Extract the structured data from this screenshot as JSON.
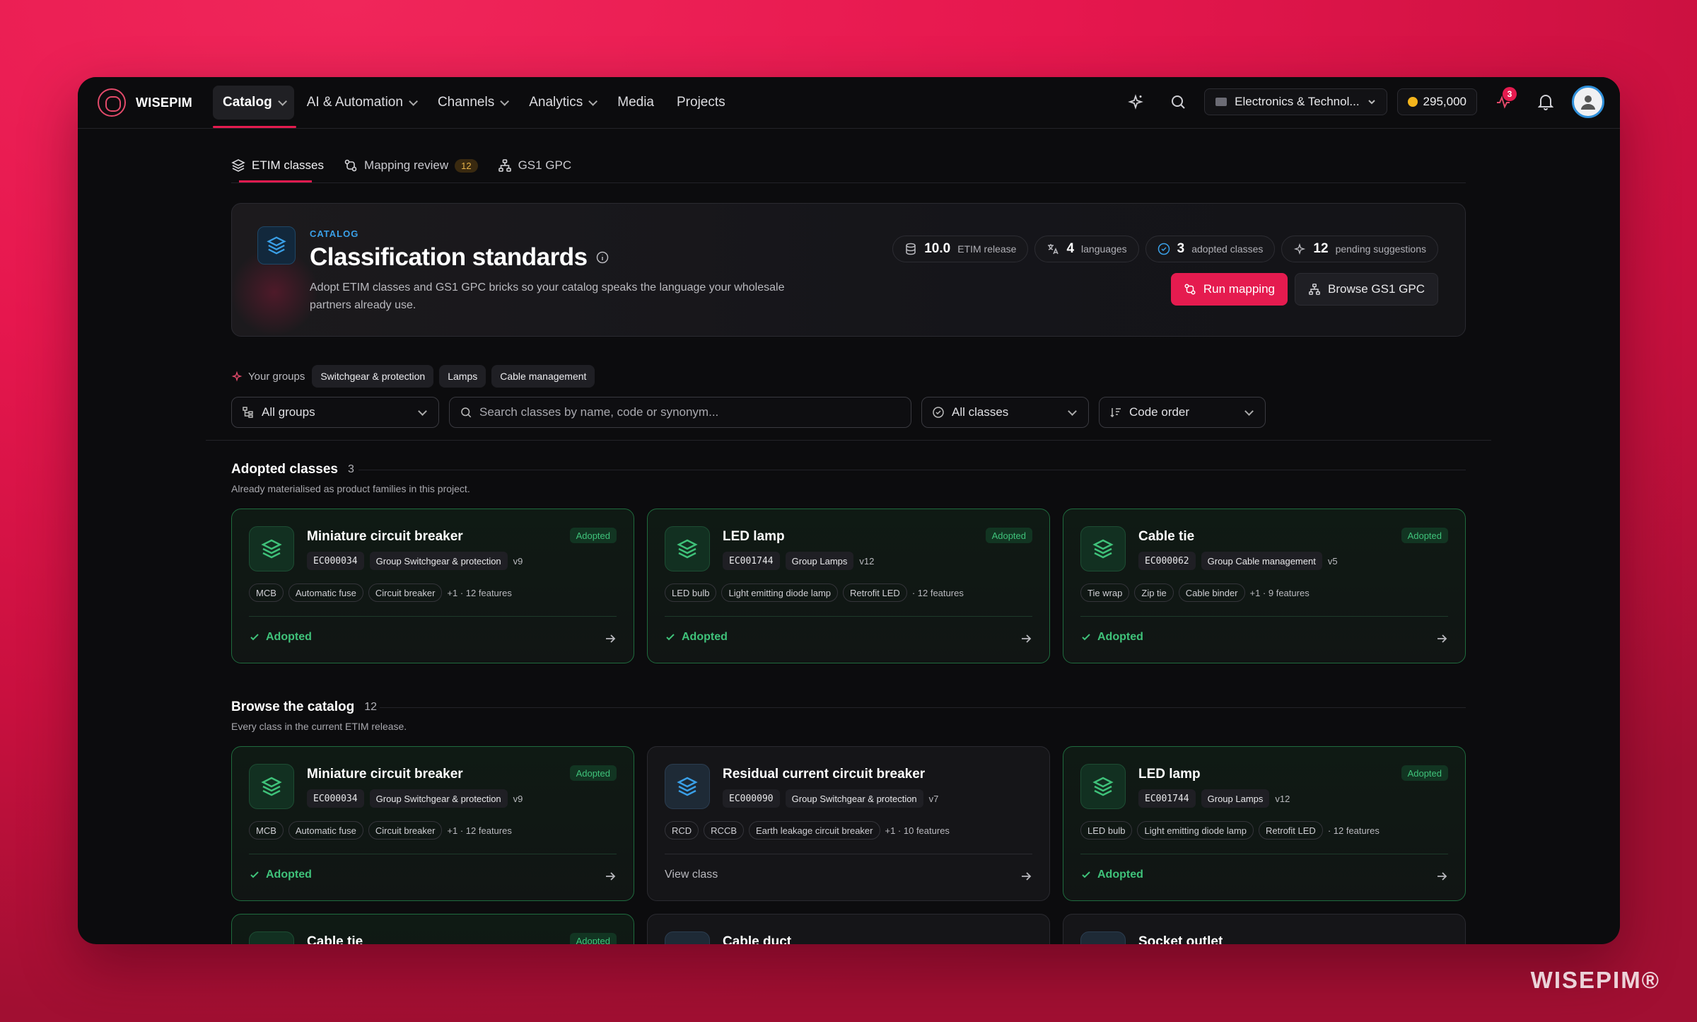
{
  "nav": {
    "logo": "WISEPIM",
    "menu": [
      {
        "label": "Catalog"
      },
      {
        "label": "AI & Automation"
      },
      {
        "label": "Channels"
      },
      {
        "label": "Analytics"
      },
      {
        "label": "Media"
      },
      {
        "label": "Projects"
      }
    ],
    "workspace": "Electronics & Technol...",
    "credits": "295,000",
    "notification_count": "3"
  },
  "subtabs": [
    {
      "label": "ETIM classes"
    },
    {
      "label": "Mapping review",
      "count": "12"
    },
    {
      "label": "GS1 GPC"
    }
  ],
  "hero": {
    "eyebrow": "CATALOG",
    "title": "Classification standards",
    "description": "Adopt ETIM classes and GS1 GPC bricks so your catalog speaks the language your wholesale partners already use.",
    "stats": [
      {
        "value": "10.0",
        "label": "ETIM release"
      },
      {
        "value": "4",
        "label": "languages"
      },
      {
        "value": "3",
        "label": "adopted classes"
      },
      {
        "value": "12",
        "label": "pending suggestions"
      }
    ],
    "run_mapping": "Run mapping",
    "browse_gs1": "Browse GS1 GPC"
  },
  "groups": {
    "label": "Your groups",
    "chips": [
      "Switchgear & protection",
      "Lamps",
      "Cable management"
    ]
  },
  "filters": {
    "groups": "All groups",
    "search_placeholder": "Search classes by name, code or synonym...",
    "classes": "All classes",
    "order": "Code order"
  },
  "adopted_section": {
    "title": "Adopted classes",
    "count": "3",
    "subtitle": "Already materialised as product families in this project."
  },
  "browse_section": {
    "title": "Browse the catalog",
    "count": "12",
    "subtitle": "Every class in the current ETIM release."
  },
  "colors": {
    "accent": "#e51b4f",
    "adopted": "#3fc27a",
    "info": "#3aa0e8"
  },
  "adopted_cards": [
    {
      "title": "Miniature circuit breaker",
      "tag": "Adopted",
      "code": "EC000034",
      "group": "Group Switchgear & protection",
      "version": "v9",
      "synonyms": [
        "MCB",
        "Automatic fuse",
        "Circuit breaker"
      ],
      "more": "+1 · 12 features",
      "footer": "Adopted"
    },
    {
      "title": "LED lamp",
      "tag": "Adopted",
      "code": "EC001744",
      "group": "Group Lamps",
      "version": "v12",
      "synonyms": [
        "LED bulb",
        "Light emitting diode lamp",
        "Retrofit LED"
      ],
      "more": "· 12 features",
      "footer": "Adopted"
    },
    {
      "title": "Cable tie",
      "tag": "Adopted",
      "code": "EC000062",
      "group": "Group Cable management",
      "version": "v5",
      "synonyms": [
        "Tie wrap",
        "Zip tie",
        "Cable binder"
      ],
      "more": "+1 · 9 features",
      "footer": "Adopted"
    }
  ],
  "browse_cards": [
    {
      "title": "Miniature circuit breaker",
      "tag": "Adopted",
      "code": "EC000034",
      "group": "Group Switchgear & protection",
      "version": "v9",
      "synonyms": [
        "MCB",
        "Automatic fuse",
        "Circuit breaker"
      ],
      "more": "+1 · 12 features",
      "footer": "Adopted"
    },
    {
      "title": "Residual current circuit breaker",
      "tag": "",
      "code": "EC000090",
      "group": "Group Switchgear & protection",
      "version": "v7",
      "synonyms": [
        "RCD",
        "RCCB",
        "Earth leakage circuit breaker"
      ],
      "more": "+1 · 10 features",
      "footer": "View class"
    },
    {
      "title": "LED lamp",
      "tag": "Adopted",
      "code": "EC001744",
      "group": "Group Lamps",
      "version": "v12",
      "synonyms": [
        "LED bulb",
        "Light emitting diode lamp",
        "Retrofit LED"
      ],
      "more": "· 12 features",
      "footer": "Adopted"
    },
    {
      "title": "Cable tie",
      "tag": "Adopted"
    },
    {
      "title": "Cable duct",
      "tag": ""
    },
    {
      "title": "Socket outlet",
      "tag": ""
    }
  ],
  "watermark": "WISEPIM®"
}
